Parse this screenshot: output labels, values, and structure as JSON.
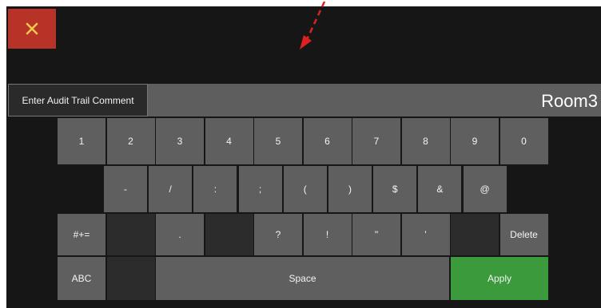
{
  "close_icon": "close-icon",
  "accent_colors": {
    "close": "#b73227",
    "apply": "#3b9a3b",
    "annotation": "#e02020"
  },
  "comment": {
    "label": "Enter Audit Trail Comment",
    "value": "Room3"
  },
  "keyboard": {
    "row1": [
      "1",
      "2",
      "3",
      "4",
      "5",
      "6",
      "7",
      "8",
      "9",
      "0"
    ],
    "row2": [
      "-",
      "/",
      ":",
      ";",
      "(",
      ")",
      "$",
      "&",
      "@"
    ],
    "row3": [
      "#+=",
      "",
      ".",
      "",
      "?",
      "!",
      "\"",
      "'",
      "",
      "Delete"
    ],
    "row4": {
      "abc": "ABC",
      "space": "Space",
      "apply": "Apply"
    }
  }
}
